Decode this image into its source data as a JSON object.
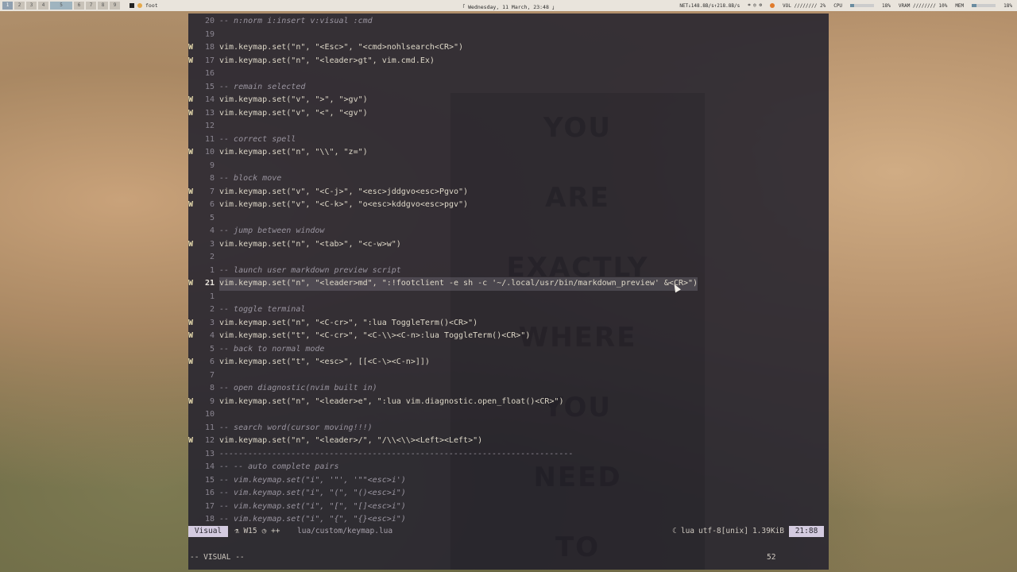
{
  "topbar": {
    "workspaces": [
      "1",
      "2",
      "3",
      "4",
      "5",
      "6",
      "7",
      "8",
      "9"
    ],
    "active_app": "foot",
    "clock": "「 Wednesday, 11 March, 23:48 」",
    "net": "NET↓148.8B/s↑218.8B/s",
    "vol": "VOL //////// 2%",
    "cpu_label": "CPU",
    "cpu_value": "18%",
    "cpu_fill": 0.18,
    "vram": "VRAM //////// 10%",
    "mem_label": "MEM",
    "mem_value": "18%",
    "mem_fill": 0.18
  },
  "editor": {
    "lines": [
      {
        "sign": "",
        "num": "20",
        "text": "-- n:norm i:insert v:visual :cmd",
        "type": "comment"
      },
      {
        "sign": "",
        "num": "19",
        "text": "",
        "type": "code"
      },
      {
        "sign": "W",
        "num": "18",
        "text": "vim.keymap.set(\"n\", \"<Esc>\", \"<cmd>nohlsearch<CR>\")",
        "type": "code"
      },
      {
        "sign": "W",
        "num": "17",
        "text": "vim.keymap.set(\"n\", \"<leader>gt\", vim.cmd.Ex)",
        "type": "code"
      },
      {
        "sign": "",
        "num": "16",
        "text": "",
        "type": "code"
      },
      {
        "sign": "",
        "num": "15",
        "text": "-- remain selected",
        "type": "comment"
      },
      {
        "sign": "W",
        "num": "14",
        "text": "vim.keymap.set(\"v\", \">\", \">gv\")",
        "type": "code"
      },
      {
        "sign": "W",
        "num": "13",
        "text": "vim.keymap.set(\"v\", \"<\", \"<gv\")",
        "type": "code"
      },
      {
        "sign": "",
        "num": "12",
        "text": "",
        "type": "code"
      },
      {
        "sign": "",
        "num": "11",
        "text": "-- correct spell",
        "type": "comment"
      },
      {
        "sign": "W",
        "num": "10",
        "text": "vim.keymap.set(\"n\", \"\\\\\", \"z=\")",
        "type": "code"
      },
      {
        "sign": "",
        "num": "9",
        "text": "",
        "type": "code"
      },
      {
        "sign": "",
        "num": "8",
        "text": "-- block move",
        "type": "comment"
      },
      {
        "sign": "W",
        "num": "7",
        "text": "vim.keymap.set(\"v\", \"<C-j>\", \"<esc>jddgvo<esc>Pgvo\")",
        "type": "code"
      },
      {
        "sign": "W",
        "num": "6",
        "text": "vim.keymap.set(\"v\", \"<C-k>\", \"o<esc>kddgvo<esc>pgv\")",
        "type": "code"
      },
      {
        "sign": "",
        "num": "5",
        "text": "",
        "type": "code"
      },
      {
        "sign": "",
        "num": "4",
        "text": "-- jump between window",
        "type": "comment"
      },
      {
        "sign": "W",
        "num": "3",
        "text": "vim.keymap.set(\"n\", \"<tab>\", \"<c-w>w\")",
        "type": "code"
      },
      {
        "sign": "",
        "num": "2",
        "text": "",
        "type": "code"
      },
      {
        "sign": "",
        "num": "1",
        "text": "-- launch user markdown preview script",
        "type": "comment"
      },
      {
        "sign": "W",
        "num": "21",
        "text": "vim.keymap.set(\"n\", \"<leader>md\", \":!footclient -e sh -c '~/.local/usr/bin/markdown_preview' &<CR>\")",
        "type": "current"
      },
      {
        "sign": "",
        "num": "1",
        "text": "",
        "type": "code"
      },
      {
        "sign": "",
        "num": "2",
        "text": "-- toggle terminal",
        "type": "comment"
      },
      {
        "sign": "W",
        "num": "3",
        "text": "vim.keymap.set(\"n\", \"<C-cr>\", \":lua ToggleTerm()<CR>\")",
        "type": "code"
      },
      {
        "sign": "W",
        "num": "4",
        "text": "vim.keymap.set(\"t\", \"<C-cr>\", \"<C-\\\\><C-n>:lua ToggleTerm()<CR>\")",
        "type": "code"
      },
      {
        "sign": "",
        "num": "5",
        "text": "-- back to normal mode",
        "type": "comment"
      },
      {
        "sign": "W",
        "num": "6",
        "text": "vim.keymap.set(\"t\", \"<esc>\", [[<C-\\><C-n>]])",
        "type": "code"
      },
      {
        "sign": "",
        "num": "7",
        "text": "",
        "type": "code"
      },
      {
        "sign": "",
        "num": "8",
        "text": "-- open diagnostic(nvim built in)",
        "type": "comment"
      },
      {
        "sign": "W",
        "num": "9",
        "text": "vim.keymap.set(\"n\", \"<leader>e\", \":lua vim.diagnostic.open_float()<CR>\")",
        "type": "code"
      },
      {
        "sign": "",
        "num": "10",
        "text": "",
        "type": "code"
      },
      {
        "sign": "",
        "num": "11",
        "text": "-- search word(cursor moving!!!)",
        "type": "comment"
      },
      {
        "sign": "W",
        "num": "12",
        "text": "vim.keymap.set(\"n\", \"<leader>/\", \"/\\\\<\\\\><Left><Left>\")",
        "type": "code"
      },
      {
        "sign": "",
        "num": "13",
        "text": "--------------------------------------------------------------------------",
        "type": "comment"
      },
      {
        "sign": "",
        "num": "14",
        "text": "-- -- auto complete pairs",
        "type": "comment"
      },
      {
        "sign": "",
        "num": "15",
        "text": "-- vim.keymap.set(\"i\", '\"', '\"\"<esc>i')",
        "type": "comment"
      },
      {
        "sign": "",
        "num": "16",
        "text": "-- vim.keymap.set(\"i\", \"(\", \"()<esc>i\")",
        "type": "comment"
      },
      {
        "sign": "",
        "num": "17",
        "text": "-- vim.keymap.set(\"i\", \"[\", \"[]<esc>i\")",
        "type": "comment"
      },
      {
        "sign": "",
        "num": "18",
        "text": "-- vim.keymap.set(\"i\", \"{\", \"{}<esc>i\")",
        "type": "comment"
      }
    ],
    "background_words": [
      "YOU",
      "ARE",
      "EXACTLY",
      "WHERE",
      "YOU",
      "NEED",
      "TO"
    ]
  },
  "statusline": {
    "mode": "Visual",
    "warnings": "W15",
    "modified": "++",
    "file": "lua/custom/keymap.lua",
    "filetype": "lua",
    "encoding": "utf-8[unix]",
    "size": "1.39KiB",
    "position": "21:88"
  },
  "cmdline": {
    "mode_text": "-- VISUAL --",
    "count": "52"
  },
  "colors": {
    "mode_bg": "#d4cbe0",
    "terminal_bg": "#282630",
    "sign_warning": "#e8dcae"
  }
}
